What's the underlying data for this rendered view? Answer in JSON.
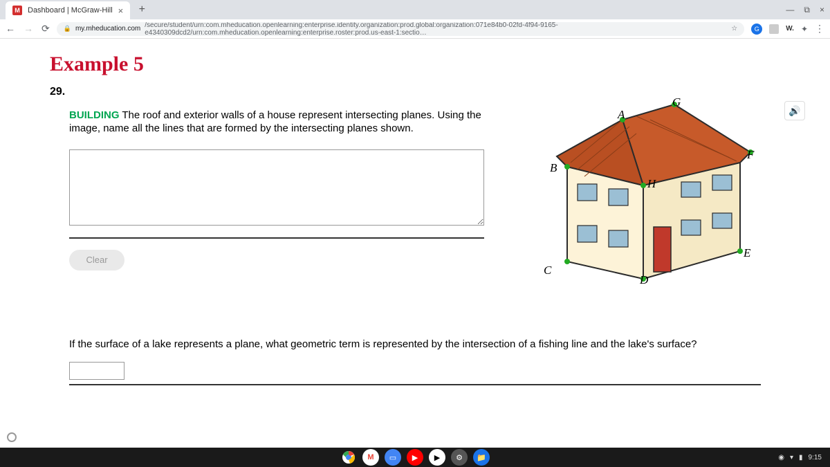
{
  "browser": {
    "tab_title": "Dashboard | McGraw-Hill",
    "favicon_letter": "M",
    "url_domain": "my.mheducation.com",
    "url_path": "/secure/student/urn:com.mheducation.openlearning:enterprise.identity.organization:prod.global:organization:071e84b0-02fd-4f94-9165-e4340309dcd2/urn:com.mheducation.openlearning:enterprise.roster:prod.us-east-1:sectio…",
    "ext_w": "W."
  },
  "page": {
    "title": "Example 5",
    "question_number": "29.",
    "q1_tag": "BUILDING",
    "q1_text": "  The roof and exterior walls of a house represent intersecting planes. Using the image, name all the lines that are formed by the intersecting planes shown.",
    "clear_label": "Clear",
    "q2_text": "If the surface of a lake represents a plane, what geometric term is represented by the intersection of a fishing line and the lake's surface?",
    "labels": {
      "A": "A",
      "B": "B",
      "C": "C",
      "D": "D",
      "E": "E",
      "F": "F",
      "G": "G",
      "H": "H"
    }
  },
  "tray": {
    "time": "9:15"
  }
}
